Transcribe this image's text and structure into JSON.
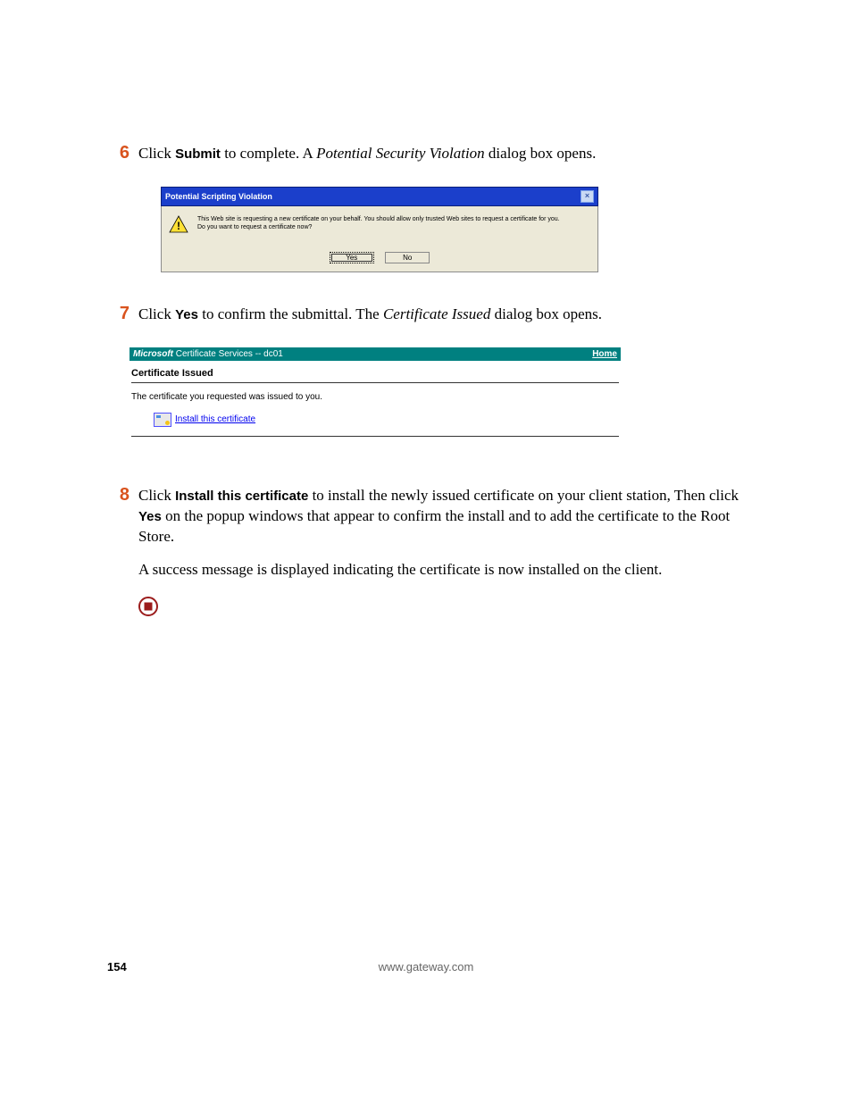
{
  "steps": {
    "s6": {
      "num": "6",
      "parts": {
        "p1": "Click ",
        "b1": "Submit",
        "p2": " to complete. A ",
        "i1": "Potential Security Violation",
        "p3": " dialog box opens."
      }
    },
    "s7": {
      "num": "7",
      "parts": {
        "p1": "Click ",
        "b1": "Yes",
        "p2": " to confirm the submittal. The ",
        "i1": "Certificate Issued",
        "p3": " dialog box opens."
      }
    },
    "s8": {
      "num": "8",
      "parts": {
        "p1": "Click ",
        "b1": "Install this certificate",
        "p2": " to install the newly issued certificate on your client station, Then click ",
        "b2": "Yes",
        "p3": " on the popup windows that appear to confirm the install and to add the certificate to the Root Store."
      },
      "para2": "A success message is displayed indicating the certificate is now installed on the client."
    }
  },
  "dlg1": {
    "title": "Potential Scripting Violation",
    "line1": "This Web site is requesting a new certificate on your behalf. You should allow only trusted Web sites to request a certificate for you.",
    "line2": "Do you want to request a certificate now?",
    "yes": "Yes",
    "no": "No"
  },
  "dlg2": {
    "brand": "Microsoft",
    "svc": " Certificate Services  --  dc01",
    "home": "Home",
    "heading": "Certificate Issued",
    "msg": "The certificate you requested was issued to you.",
    "link": "Install this certificate"
  },
  "footer": {
    "page": "154",
    "url": "www.gateway.com"
  }
}
